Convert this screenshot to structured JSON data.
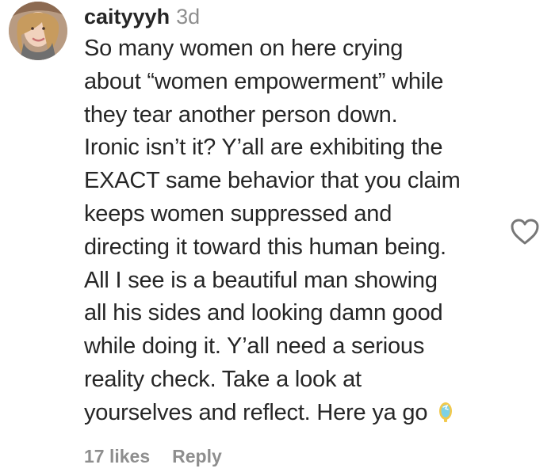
{
  "comment": {
    "username": "caityyyh",
    "timestamp": "3d",
    "lines": [
      "So many women on here crying",
      "about “women empowerment” while",
      "they tear another person down.",
      "Ironic isn’t it? Y’all are exhibiting the",
      "EXACT same behavior that you claim",
      "keeps women suppressed and",
      "directing it toward this human being.",
      "All I see is a beautiful man showing",
      "all his sides and looking damn good",
      "while doing it. Y’all need a serious",
      "reality check. Take a look at",
      "yourselves and reflect. Here ya go"
    ],
    "emoji_icon": "mirror-emoji-icon",
    "likes": "17 likes",
    "reply_label": "Reply",
    "heart_icon": "heart-outline-icon"
  },
  "colors": {
    "text": "#262626",
    "muted": "#8e8e8e",
    "mirror_frame": "#f2c94c",
    "mirror_glass": "#7ed1e6"
  }
}
